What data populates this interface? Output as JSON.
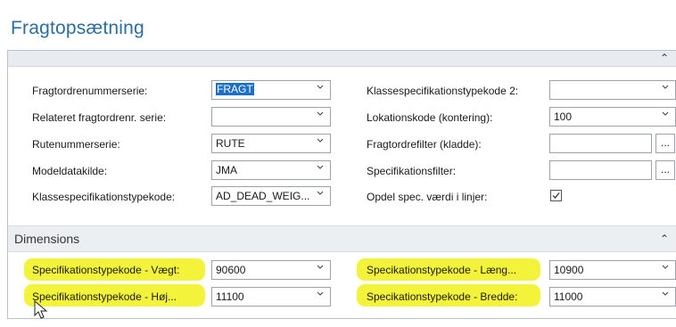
{
  "page_title": "Fragtopsætning",
  "general": {
    "left": [
      {
        "label": "Fragtordrenummerserie:",
        "value": "FRAGT"
      },
      {
        "label": "Relateret fragtordrenr. serie:",
        "value": ""
      },
      {
        "label": "Rutenummerserie:",
        "value": "RUTE"
      },
      {
        "label": "Modeldatakilde:",
        "value": "JMA"
      },
      {
        "label": "Klassespecifikationstypekode:",
        "value": "AD_DEAD_WEIG..."
      }
    ],
    "right": [
      {
        "label": "Klassespecification typekode 2:",
        "value": ""
      },
      {
        "label": "Lokationskode (kontering):",
        "value": "100"
      },
      {
        "label": "Fragtordrefilter (kladde):",
        "value": ""
      },
      {
        "label": "Specifikationsfilter:",
        "value": ""
      },
      {
        "label": "Opdel spec. værdi i linjer:",
        "value": "checked"
      }
    ],
    "dots_label": "..."
  },
  "dimensions": {
    "header": "Dimensions",
    "left": [
      {
        "label": "Specifikationstypekode - Vægt:",
        "value": "90600"
      },
      {
        "label": "Specifikationstypekode - Høj...",
        "value": "11100"
      }
    ],
    "right": [
      {
        "label": "Specikationstypekode - Læng...",
        "value": "10900"
      },
      {
        "label": "Specikationstypekode - Bredde:",
        "value": "11000"
      }
    ]
  },
  "colors": {
    "title": "#2b6d9e",
    "highlight": "#f2f232",
    "selection": "#1e6fc9"
  }
}
